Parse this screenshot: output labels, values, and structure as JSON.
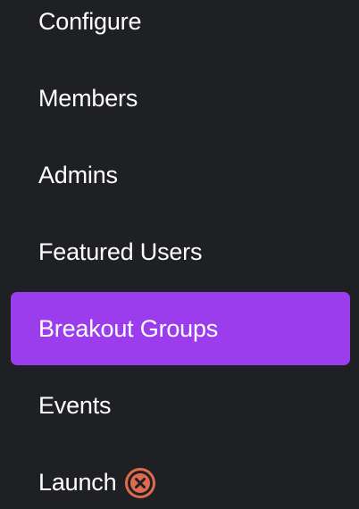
{
  "nav": {
    "items": [
      {
        "label": "Configure"
      },
      {
        "label": "Members"
      },
      {
        "label": "Admins"
      },
      {
        "label": "Featured Users"
      },
      {
        "label": "Breakout Groups",
        "active": true
      },
      {
        "label": "Events"
      },
      {
        "label": "Launch",
        "status_icon": "close-circle-icon"
      }
    ]
  },
  "colors": {
    "background": "#1f2023",
    "active": "#9b3ded",
    "text": "#ffffff",
    "status_icon": "#e06a4f"
  }
}
